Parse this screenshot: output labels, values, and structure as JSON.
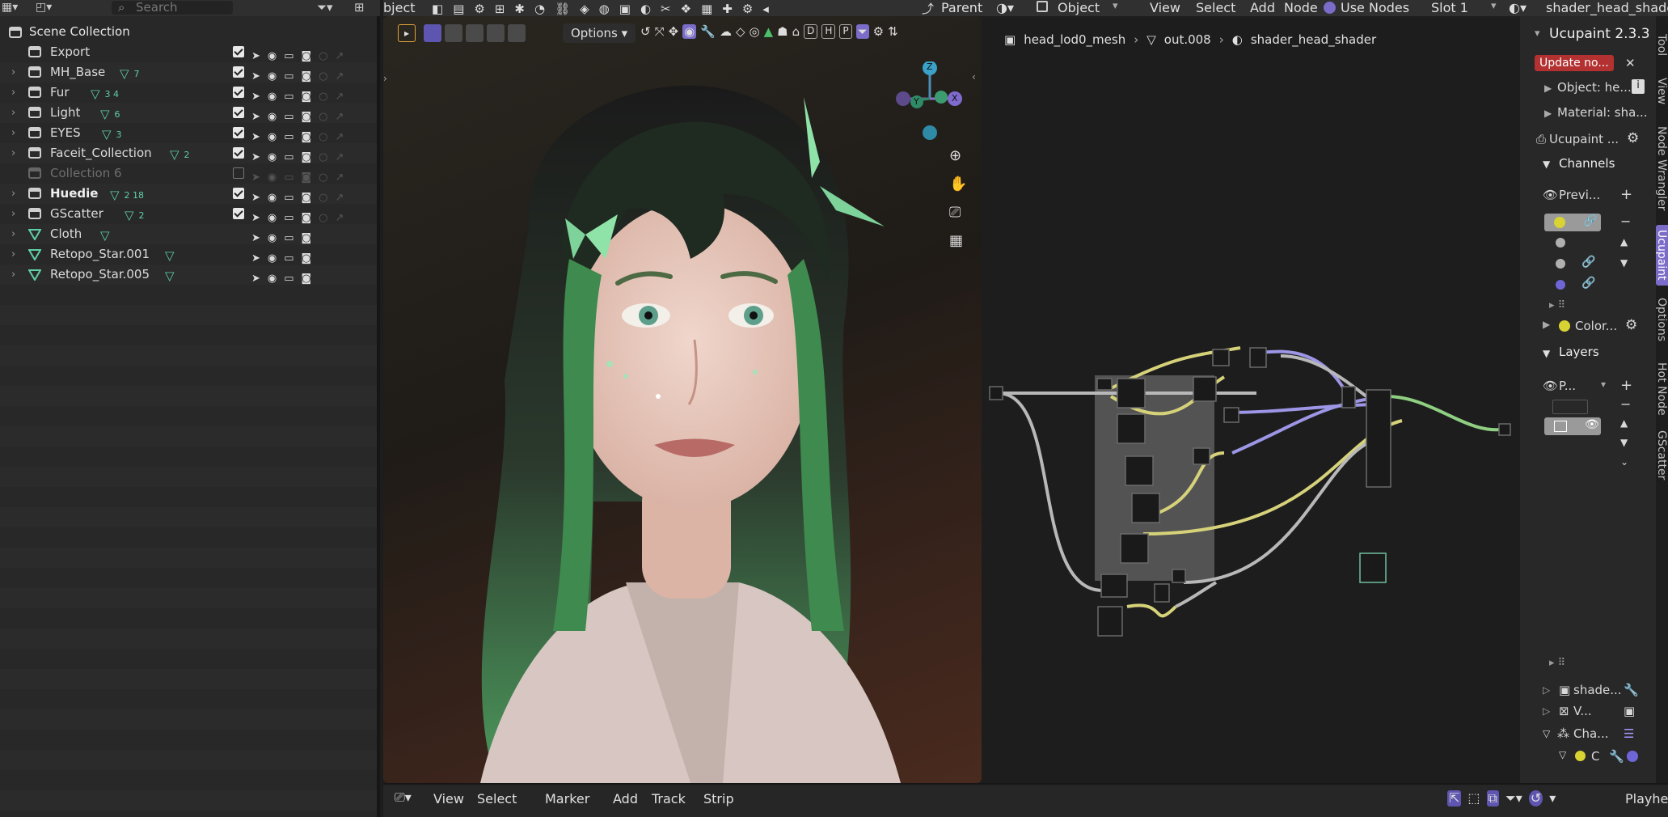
{
  "outliner": {
    "search_placeholder": "Search",
    "root_label": "Scene Collection",
    "rows": [
      {
        "label": "Export",
        "style": "normal",
        "badge": ""
      },
      {
        "label": "MH_Base",
        "style": "normal",
        "badge": "7"
      },
      {
        "label": "Fur",
        "style": "normal",
        "badge": "3 4"
      },
      {
        "label": "Light",
        "style": "normal",
        "badge": "6"
      },
      {
        "label": "EYES",
        "style": "normal",
        "badge": "3"
      },
      {
        "label": "Faceit_Collection",
        "style": "normal",
        "badge": "2"
      },
      {
        "label": "Collection 6",
        "style": "dim",
        "badge": ""
      },
      {
        "label": "Huedie",
        "style": "bold",
        "badge": "2 18"
      },
      {
        "label": "GScatter",
        "style": "normal",
        "badge": "2"
      },
      {
        "label": "Cloth",
        "style": "normal",
        "badge": ""
      },
      {
        "label": "Retopo_Star.001",
        "style": "normal",
        "badge": ""
      },
      {
        "label": "Retopo_Star.005",
        "style": "normal",
        "badge": ""
      }
    ]
  },
  "topbar": {
    "object_menu_fragment": "bject",
    "parent_label": "Parent",
    "mode_label": "Object",
    "view_label": "View",
    "select_label": "Select",
    "add_label": "Add",
    "node_label": "Node",
    "use_nodes_label": "Use Nodes",
    "slot_label": "Slot 1",
    "material_name": "shader_head_shader"
  },
  "viewport": {
    "options_label": "Options",
    "axis_z": "Z",
    "axis_y": "Y",
    "axis_x": "X",
    "header_letters": [
      "D",
      "H",
      "P"
    ]
  },
  "node_editor": {
    "breadcrumb": [
      "head_lod0_mesh",
      "out.008",
      "shader_head_shader"
    ]
  },
  "n_panel": {
    "title": "Ucupaint 2.3.3",
    "update_label": "Update no...",
    "object_label": "Object: he...",
    "material_label": "Material: sha...",
    "ucupaint_label": "Ucupaint ...",
    "channels_label": "Channels",
    "preview_label": "Previ...",
    "color_label": "Color...",
    "layers_label": "Layers",
    "layer_p_label": "P...",
    "shade_label": "shade...",
    "v_label": "V...",
    "cha_label": "Cha...",
    "c_label": "C"
  },
  "vertical_tabs": [
    "Tool",
    "View",
    "Node Wrangler",
    "Ucupaint",
    "Options",
    "Hot Node",
    "GScatter"
  ],
  "bottombar": {
    "view_label": "View",
    "select_label": "Select",
    "marker_label": "Marker",
    "add_label": "Add",
    "track_label": "Track",
    "strip_label": "Strip",
    "playhead_label": "Playhead"
  },
  "colors": {
    "accent": "#7a6cc8",
    "green_icon": "#5fcfa5",
    "wire_yellow": "#d6d27a",
    "wire_gray": "#b8b8b8",
    "wire_purple": "#9d96e6",
    "wire_green": "#8fcf82",
    "update_red": "#b43131"
  }
}
